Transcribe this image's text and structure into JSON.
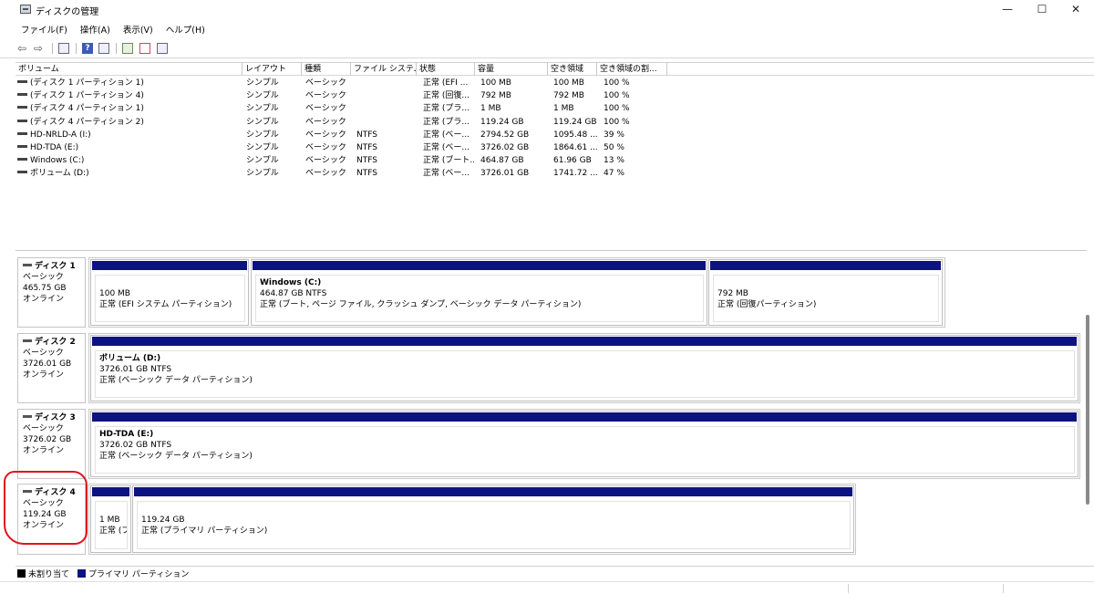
{
  "window": {
    "title": "ディスクの管理",
    "controls": {
      "minimize": "—",
      "maximize": "☐",
      "close": "✕"
    }
  },
  "menu": [
    "ファイル(F)",
    "操作(A)",
    "表示(V)",
    "ヘルプ(H)"
  ],
  "toolbar": {
    "icons": [
      "back-arrow-icon",
      "forward-arrow-icon",
      "properties-icon",
      "help-icon",
      "view-icon",
      "rescan-icon",
      "check-icon",
      "list-icon"
    ],
    "back": "⇦",
    "forward": "⇨",
    "help": "?"
  },
  "volume_list": {
    "columns": [
      "ボリューム",
      "レイアウト",
      "種類",
      "ファイル システム",
      "状態",
      "容量",
      "空き領域",
      "空き領域の割..."
    ],
    "rows": [
      {
        "volume": "(ディスク 1 パーティション 1)",
        "layout": "シンプル",
        "type": "ベーシック",
        "fs": "",
        "status": "正常 (EFI ...",
        "capacity": "100 MB",
        "free": "100 MB",
        "pct": "100 %"
      },
      {
        "volume": "(ディスク 1 パーティション 4)",
        "layout": "シンプル",
        "type": "ベーシック",
        "fs": "",
        "status": "正常 (回復...",
        "capacity": "792 MB",
        "free": "792 MB",
        "pct": "100 %"
      },
      {
        "volume": "(ディスク 4 パーティション 1)",
        "layout": "シンプル",
        "type": "ベーシック",
        "fs": "",
        "status": "正常 (プラ...",
        "capacity": "1 MB",
        "free": "1 MB",
        "pct": "100 %"
      },
      {
        "volume": "(ディスク 4 パーティション 2)",
        "layout": "シンプル",
        "type": "ベーシック",
        "fs": "",
        "status": "正常 (プラ...",
        "capacity": "119.24 GB",
        "free": "119.24 GB",
        "pct": "100 %"
      },
      {
        "volume": "HD-NRLD-A (I:)",
        "layout": "シンプル",
        "type": "ベーシック",
        "fs": "NTFS",
        "status": "正常 (ベー...",
        "capacity": "2794.52 GB",
        "free": "1095.48 ...",
        "pct": "39 %"
      },
      {
        "volume": "HD-TDA (E:)",
        "layout": "シンプル",
        "type": "ベーシック",
        "fs": "NTFS",
        "status": "正常 (ベー...",
        "capacity": "3726.02 GB",
        "free": "1864.61 ...",
        "pct": "50 %"
      },
      {
        "volume": "Windows (C:)",
        "layout": "シンプル",
        "type": "ベーシック",
        "fs": "NTFS",
        "status": "正常 (ブート...",
        "capacity": "464.87 GB",
        "free": "61.96 GB",
        "pct": "13 %"
      },
      {
        "volume": "ボリューム (D:)",
        "layout": "シンプル",
        "type": "ベーシック",
        "fs": "NTFS",
        "status": "正常 (ベー...",
        "capacity": "3726.01 GB",
        "free": "1741.72 ...",
        "pct": "47 %"
      }
    ]
  },
  "disks": [
    {
      "name": "ディスク 1",
      "type": "ベーシック",
      "size": "465.75 GB",
      "state": "オンライン",
      "partitions": [
        {
          "name": "",
          "line1": "100 MB",
          "line2": "正常 (EFI システム パーティション)"
        },
        {
          "name": "Windows  (C:)",
          "line1": "464.87 GB NTFS",
          "line2": "正常 (ブート, ページ ファイル, クラッシュ ダンプ, ベーシック データ パーティション)"
        },
        {
          "name": "",
          "line1": "792 MB",
          "line2": "正常 (回復パーティション)"
        }
      ]
    },
    {
      "name": "ディスク 2",
      "type": "ベーシック",
      "size": "3726.01 GB",
      "state": "オンライン",
      "partitions": [
        {
          "name": "ボリューム  (D:)",
          "line1": "3726.01 GB NTFS",
          "line2": "正常 (ベーシック データ パーティション)"
        }
      ]
    },
    {
      "name": "ディスク 3",
      "type": "ベーシック",
      "size": "3726.02 GB",
      "state": "オンライン",
      "partitions": [
        {
          "name": "HD-TDA  (E:)",
          "line1": "3726.02 GB NTFS",
          "line2": "正常 (ベーシック データ パーティション)"
        }
      ]
    },
    {
      "name": "ディスク 4",
      "type": "ベーシック",
      "size": "119.24 GB",
      "state": "オンライン",
      "partitions": [
        {
          "name": "",
          "line1": "1 MB",
          "line2": "正常 (プ"
        },
        {
          "name": "",
          "line1": "119.24 GB",
          "line2": "正常 (プライマリ パーティション)"
        }
      ]
    }
  ],
  "legend": [
    {
      "label": "未割り当て",
      "color": "#000000"
    },
    {
      "label": "プライマリ パーティション",
      "color": "#0c1281"
    }
  ],
  "colors": {
    "partition_bar": "#0c1281",
    "annotation": "#e0141b"
  }
}
